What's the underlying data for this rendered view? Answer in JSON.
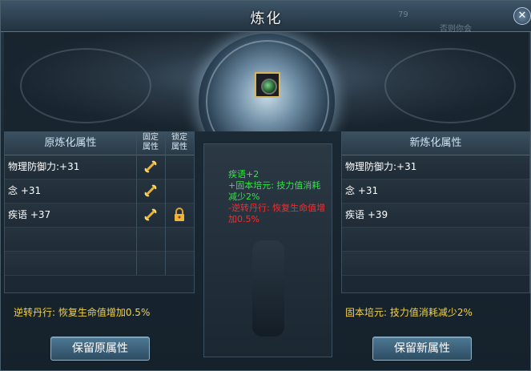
{
  "window": {
    "title": "炼化",
    "close_label": "✕",
    "bg_hint_a": "79",
    "bg_hint_b": "否则你会"
  },
  "left_panel": {
    "header": "原炼化属性",
    "col_fixed": "固定\n属性",
    "col_lock": "锁定\n属性",
    "rows": [
      {
        "text": "物理防御力:+31",
        "fixed": true,
        "locked": false
      },
      {
        "text": "念 +31",
        "fixed": true,
        "locked": false
      },
      {
        "text": "疾语 +37",
        "fixed": true,
        "locked": true
      }
    ],
    "special": "逆转丹行: 恢复生命值增加0.5%",
    "button": "保留原属性"
  },
  "right_panel": {
    "header": "新炼化属性",
    "rows": [
      {
        "text": "物理防御力:+31"
      },
      {
        "text": "念 +31"
      },
      {
        "text": "疾语 +39"
      }
    ],
    "special": "固本培元: 技力值消耗减少2%",
    "button": "保留新属性"
  },
  "middle": {
    "lines": [
      {
        "text": "疾语+2",
        "color": "#35e04a"
      },
      {
        "text": "+固本培元: 技力值消耗减少2%",
        "color": "#35e04a"
      },
      {
        "text": "-逆转丹行: 恢复生命值增加0.5%",
        "color": "#ff2a2a"
      }
    ]
  },
  "colors": {
    "gold": "#f2d34a",
    "green": "#35e04a",
    "red": "#ff2a2a",
    "accent": "#8fb3c9"
  },
  "icons": {
    "slot_item": "ring-icon",
    "fixed": "chain-link-icon",
    "lock": "padlock-icon"
  }
}
